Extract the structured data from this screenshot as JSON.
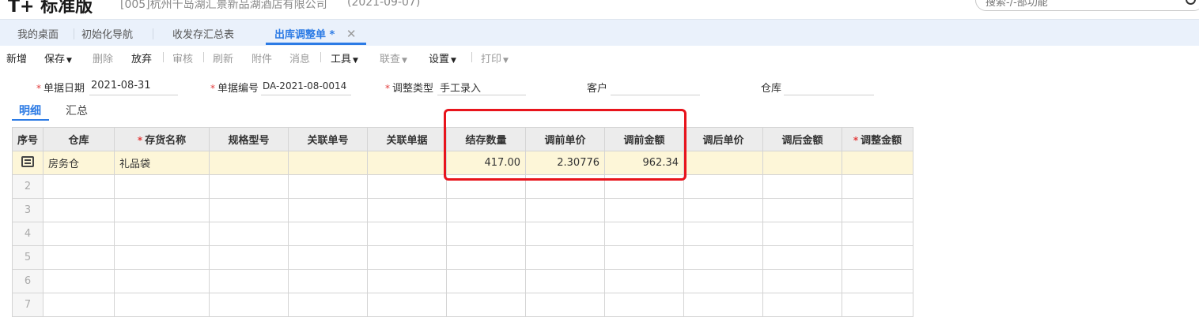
{
  "header": {
    "brand": "T+ 标准版",
    "company": "[005]杭州千岛湖汇景新品湖酒店有限公司",
    "date": "(2021-09-07)",
    "search_placeholder": "搜索-/-部功能"
  },
  "tabs": [
    {
      "label": "我的桌面"
    },
    {
      "label": "初始化导航"
    },
    {
      "label": "收发存汇总表"
    },
    {
      "label": "出库调整单 *",
      "active": true
    }
  ],
  "toolbar": {
    "new": "新增",
    "save": "保存",
    "delete": "删除",
    "discard": "放弃",
    "audit": "审核",
    "refresh": "刷新",
    "attach": "附件",
    "message": "消息",
    "tools": "工具",
    "query": "联查",
    "settings": "设置",
    "print": "打印"
  },
  "form": {
    "doc_date_label": "单据日期",
    "doc_date_value": "2021-08-31",
    "doc_no_label": "单据编号",
    "doc_no_value": "DA-2021-08-0014",
    "adjust_type_label": "调整类型",
    "adjust_type_value": "手工录入",
    "customer_label": "客户",
    "warehouse_label": "仓库"
  },
  "subtabs": {
    "detail": "明细",
    "summary": "汇总"
  },
  "grid": {
    "columns": [
      "序号",
      "仓库",
      "存货名称",
      "规格型号",
      "关联单号",
      "关联单据",
      "结存数量",
      "调前单价",
      "调前金额",
      "调后单价",
      "调后金额",
      "调整金额"
    ],
    "row1": {
      "warehouse": "房务仓",
      "item": "礼品袋",
      "qty": "417.00",
      "unit_price": "2.30776",
      "amount": "962.34"
    },
    "row_numbers": [
      "2",
      "3",
      "4",
      "5",
      "6",
      "7"
    ]
  },
  "colors": {
    "accent": "#2c7be5",
    "highlight_box": "#e8141c",
    "selected_row": "#fdf6d8"
  }
}
